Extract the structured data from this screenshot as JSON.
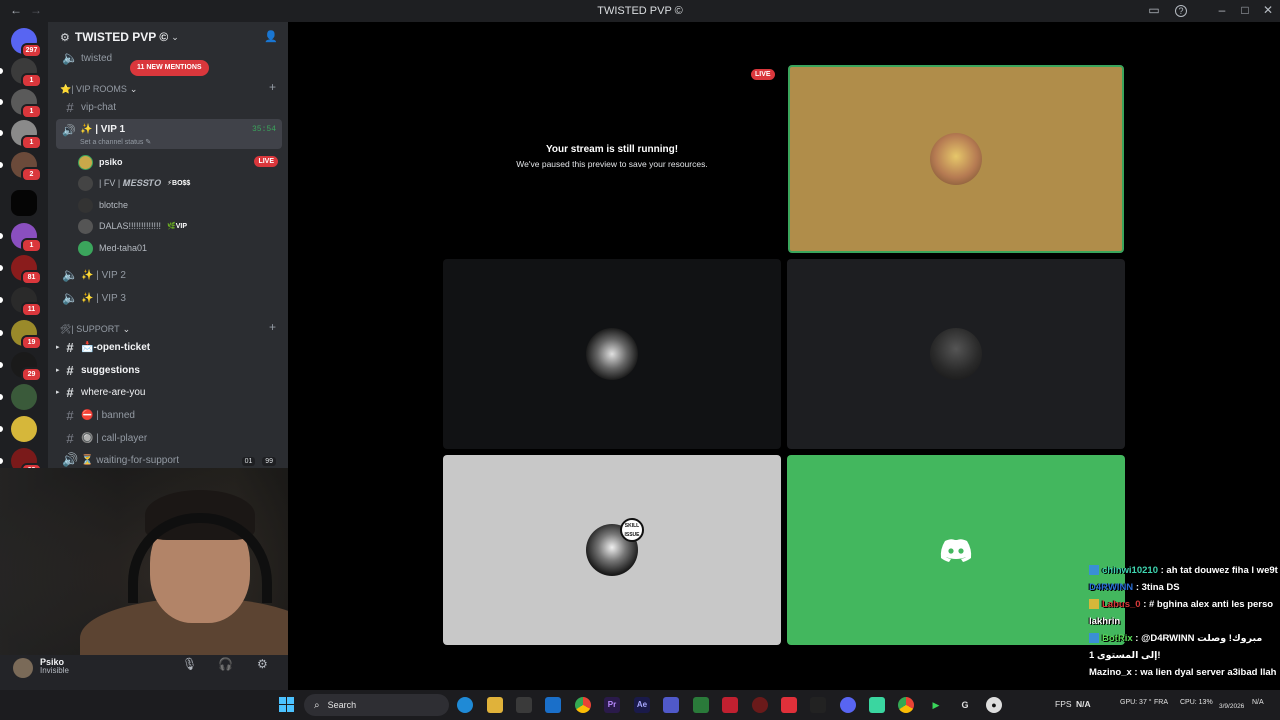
{
  "window": {
    "title": "TWISTED PVP ©",
    "back_glyph": "←",
    "forward_glyph": "→",
    "inbox_icon": "▭",
    "help_icon": "?",
    "minimize": "–",
    "maximize": "□",
    "close": "✕"
  },
  "rail": {
    "home_badge": "297",
    "badges": [
      "1",
      "1",
      "1",
      "2",
      "",
      "1",
      "81",
      "11",
      "19",
      "29",
      "",
      "28"
    ]
  },
  "server": {
    "name": "TWISTED PVP ©",
    "mentions_pill": "11 NEW MENTIONS",
    "top_channel": "twisted",
    "categories": {
      "vip": "⭐| VIP ROOMS",
      "support": "🛠| SUPPORT"
    },
    "channels": {
      "vip_chat": "vip-chat",
      "vip1": "✨ | VIP 1",
      "vip1_time": "35:54",
      "vip1_status": "Set a channel status ✎",
      "vip2": "✨ | VIP 2",
      "vip3": "✨ | VIP 3",
      "open_ticket": "📩-open-ticket",
      "suggestions": "suggestions",
      "where": "where-are-you",
      "banned": "⛔ | banned",
      "call_player": "🔘 | call-player",
      "waiting": "⏳ waiting-for-support",
      "waiting_count_a": "01",
      "waiting_count_b": "99"
    },
    "voice_users": [
      {
        "name": "psiko",
        "tag": "LIVE"
      },
      {
        "name": "| FV | 𝑴𝑬𝑺𝑺𝑻𝑶",
        "tag": "⚡BO$$"
      },
      {
        "name": "blotche",
        "tag": ""
      },
      {
        "name": "DALAS!!!!!!!!!!!!!",
        "tag": "🌿VIP"
      },
      {
        "name": "Med-taha01",
        "tag": ""
      }
    ]
  },
  "user_panel": {
    "name": "Psiko",
    "status": "Invisible"
  },
  "stage": {
    "live_badge": "LIVE",
    "paused_title": "Your stream is still running!",
    "paused_subtitle": "We've paused this preview to save your resources.",
    "skill_issue_label": "SKILL ISSUE"
  },
  "chat": [
    {
      "user": "chinwi10210",
      "text": ": ah tat douwez fiha l we9t",
      "color": "#3fd6b1"
    },
    {
      "user": "D4RWINN",
      "text": ": 3tina DS",
      "color": "#2a6fd6"
    },
    {
      "user": "Labus_0",
      "text": ": # bghina alex anti les perso lakhrin",
      "color": "#d63a3a"
    },
    {
      "user": "BotRix",
      "text": ": @D4RWINN مبروك! وصلت إلى المستوى 1!",
      "color": "#5be15b"
    },
    {
      "user": "Mazino_x",
      "text": ": wa lien dyal server a3ibad llah",
      "color": "#ffffff"
    }
  ],
  "taskbar": {
    "search_placeholder": "Search",
    "fps_label": "FPS",
    "fps_value": "N/A",
    "gpu": "GPU: 37 °",
    "cpu": "CPU: 13%",
    "lang": "FRA",
    "date": "3/9/2026",
    "extra": "N/A"
  }
}
